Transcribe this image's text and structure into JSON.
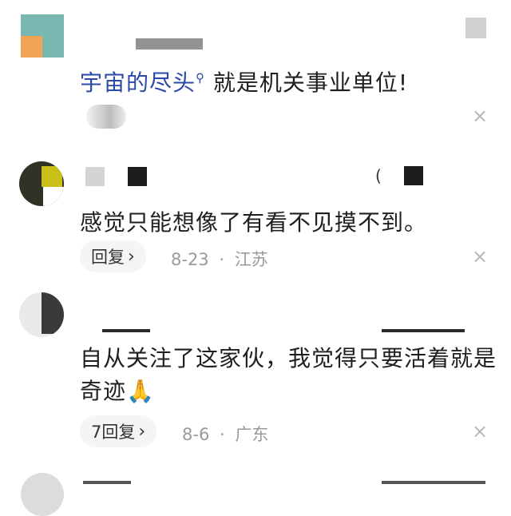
{
  "comment_1": {
    "avatar_colors": {
      "top": "#79b7b1",
      "bottom_left": "#f3a354",
      "bottom_right": "#79b7b1"
    },
    "reply_to_name": "宇宙的尽头",
    "reply_to_icon": "search-icon",
    "text": "就是机关事业单位!"
  },
  "comment_2": {
    "text": "感觉只能想像了有看不见摸不到。",
    "reply_label": "回复",
    "date": "8-23",
    "separator": "·",
    "location": "江苏"
  },
  "comment_3": {
    "text_line_1": "自从关注了这家伙，我觉得只要活着就是",
    "text_line_2": "奇迹",
    "emoji": "🙏",
    "reply_label": "7回复",
    "date": "8-6",
    "separator": "·",
    "location": "广东"
  },
  "icons": {
    "close": "×",
    "chevron": "›"
  }
}
